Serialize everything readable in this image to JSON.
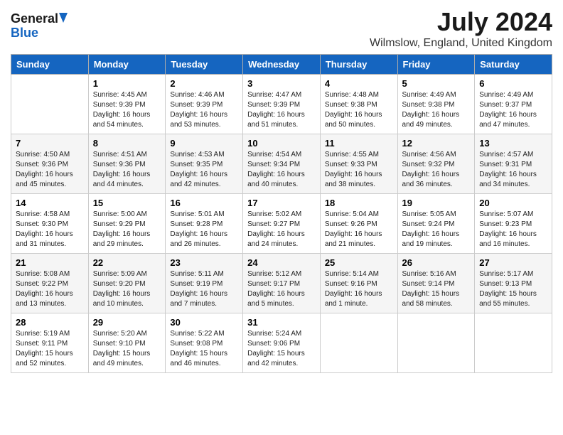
{
  "header": {
    "logo_general": "General",
    "logo_blue": "Blue",
    "month_year": "July 2024",
    "location": "Wilmslow, England, United Kingdom"
  },
  "days_of_week": [
    "Sunday",
    "Monday",
    "Tuesday",
    "Wednesday",
    "Thursday",
    "Friday",
    "Saturday"
  ],
  "weeks": [
    [
      {
        "day": "",
        "info": ""
      },
      {
        "day": "1",
        "info": "Sunrise: 4:45 AM\nSunset: 9:39 PM\nDaylight: 16 hours\nand 54 minutes."
      },
      {
        "day": "2",
        "info": "Sunrise: 4:46 AM\nSunset: 9:39 PM\nDaylight: 16 hours\nand 53 minutes."
      },
      {
        "day": "3",
        "info": "Sunrise: 4:47 AM\nSunset: 9:39 PM\nDaylight: 16 hours\nand 51 minutes."
      },
      {
        "day": "4",
        "info": "Sunrise: 4:48 AM\nSunset: 9:38 PM\nDaylight: 16 hours\nand 50 minutes."
      },
      {
        "day": "5",
        "info": "Sunrise: 4:49 AM\nSunset: 9:38 PM\nDaylight: 16 hours\nand 49 minutes."
      },
      {
        "day": "6",
        "info": "Sunrise: 4:49 AM\nSunset: 9:37 PM\nDaylight: 16 hours\nand 47 minutes."
      }
    ],
    [
      {
        "day": "7",
        "info": "Sunrise: 4:50 AM\nSunset: 9:36 PM\nDaylight: 16 hours\nand 45 minutes."
      },
      {
        "day": "8",
        "info": "Sunrise: 4:51 AM\nSunset: 9:36 PM\nDaylight: 16 hours\nand 44 minutes."
      },
      {
        "day": "9",
        "info": "Sunrise: 4:53 AM\nSunset: 9:35 PM\nDaylight: 16 hours\nand 42 minutes."
      },
      {
        "day": "10",
        "info": "Sunrise: 4:54 AM\nSunset: 9:34 PM\nDaylight: 16 hours\nand 40 minutes."
      },
      {
        "day": "11",
        "info": "Sunrise: 4:55 AM\nSunset: 9:33 PM\nDaylight: 16 hours\nand 38 minutes."
      },
      {
        "day": "12",
        "info": "Sunrise: 4:56 AM\nSunset: 9:32 PM\nDaylight: 16 hours\nand 36 minutes."
      },
      {
        "day": "13",
        "info": "Sunrise: 4:57 AM\nSunset: 9:31 PM\nDaylight: 16 hours\nand 34 minutes."
      }
    ],
    [
      {
        "day": "14",
        "info": "Sunrise: 4:58 AM\nSunset: 9:30 PM\nDaylight: 16 hours\nand 31 minutes."
      },
      {
        "day": "15",
        "info": "Sunrise: 5:00 AM\nSunset: 9:29 PM\nDaylight: 16 hours\nand 29 minutes."
      },
      {
        "day": "16",
        "info": "Sunrise: 5:01 AM\nSunset: 9:28 PM\nDaylight: 16 hours\nand 26 minutes."
      },
      {
        "day": "17",
        "info": "Sunrise: 5:02 AM\nSunset: 9:27 PM\nDaylight: 16 hours\nand 24 minutes."
      },
      {
        "day": "18",
        "info": "Sunrise: 5:04 AM\nSunset: 9:26 PM\nDaylight: 16 hours\nand 21 minutes."
      },
      {
        "day": "19",
        "info": "Sunrise: 5:05 AM\nSunset: 9:24 PM\nDaylight: 16 hours\nand 19 minutes."
      },
      {
        "day": "20",
        "info": "Sunrise: 5:07 AM\nSunset: 9:23 PM\nDaylight: 16 hours\nand 16 minutes."
      }
    ],
    [
      {
        "day": "21",
        "info": "Sunrise: 5:08 AM\nSunset: 9:22 PM\nDaylight: 16 hours\nand 13 minutes."
      },
      {
        "day": "22",
        "info": "Sunrise: 5:09 AM\nSunset: 9:20 PM\nDaylight: 16 hours\nand 10 minutes."
      },
      {
        "day": "23",
        "info": "Sunrise: 5:11 AM\nSunset: 9:19 PM\nDaylight: 16 hours\nand 7 minutes."
      },
      {
        "day": "24",
        "info": "Sunrise: 5:12 AM\nSunset: 9:17 PM\nDaylight: 16 hours\nand 5 minutes."
      },
      {
        "day": "25",
        "info": "Sunrise: 5:14 AM\nSunset: 9:16 PM\nDaylight: 16 hours\nand 1 minute."
      },
      {
        "day": "26",
        "info": "Sunrise: 5:16 AM\nSunset: 9:14 PM\nDaylight: 15 hours\nand 58 minutes."
      },
      {
        "day": "27",
        "info": "Sunrise: 5:17 AM\nSunset: 9:13 PM\nDaylight: 15 hours\nand 55 minutes."
      }
    ],
    [
      {
        "day": "28",
        "info": "Sunrise: 5:19 AM\nSunset: 9:11 PM\nDaylight: 15 hours\nand 52 minutes."
      },
      {
        "day": "29",
        "info": "Sunrise: 5:20 AM\nSunset: 9:10 PM\nDaylight: 15 hours\nand 49 minutes."
      },
      {
        "day": "30",
        "info": "Sunrise: 5:22 AM\nSunset: 9:08 PM\nDaylight: 15 hours\nand 46 minutes."
      },
      {
        "day": "31",
        "info": "Sunrise: 5:24 AM\nSunset: 9:06 PM\nDaylight: 15 hours\nand 42 minutes."
      },
      {
        "day": "",
        "info": ""
      },
      {
        "day": "",
        "info": ""
      },
      {
        "day": "",
        "info": ""
      }
    ]
  ]
}
